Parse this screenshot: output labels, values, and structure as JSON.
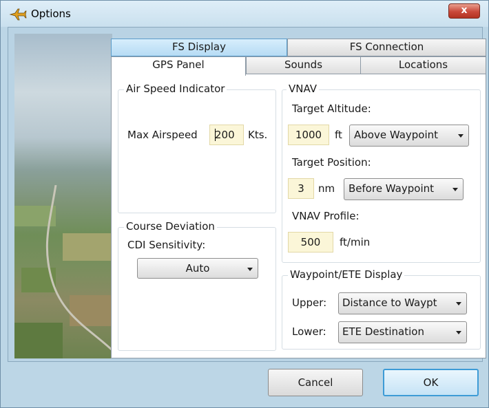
{
  "window": {
    "title": "Options",
    "close_symbol": "x"
  },
  "tabs": {
    "row1": [
      "FS Display",
      "FS Connection"
    ],
    "row2": [
      "GPS Panel",
      "Sounds",
      "Locations"
    ],
    "active": "GPS Panel"
  },
  "air_speed": {
    "legend": "Air Speed Indicator",
    "label": "Max Airspeed",
    "value": "200",
    "unit": "Kts."
  },
  "course_deviation": {
    "legend": "Course Deviation",
    "label": "CDI Sensitivity:",
    "value": "Auto"
  },
  "vnav": {
    "legend": "VNAV",
    "target_altitude_label": "Target Altitude:",
    "target_altitude_value": "1000",
    "target_altitude_unit": "ft",
    "target_altitude_ref": "Above Waypoint",
    "target_position_label": "Target Position:",
    "target_position_value": "3",
    "target_position_unit": "nm",
    "target_position_ref": "Before Waypoint",
    "profile_label": "VNAV Profile:",
    "profile_value": "500",
    "profile_unit": "ft/min"
  },
  "waypoint_display": {
    "legend": "Waypoint/ETE Display",
    "upper_label": "Upper:",
    "upper_value": "Distance to Waypt",
    "lower_label": "Lower:",
    "lower_value": "ETE Destination"
  },
  "buttons": {
    "cancel": "Cancel",
    "ok": "OK"
  },
  "colors": {
    "accent": "#3d9bd6",
    "field_bg": "#fbf6d8",
    "close_red": "#c9483a"
  },
  "icons": {
    "title": "airplane-icon",
    "close": "close-icon"
  }
}
